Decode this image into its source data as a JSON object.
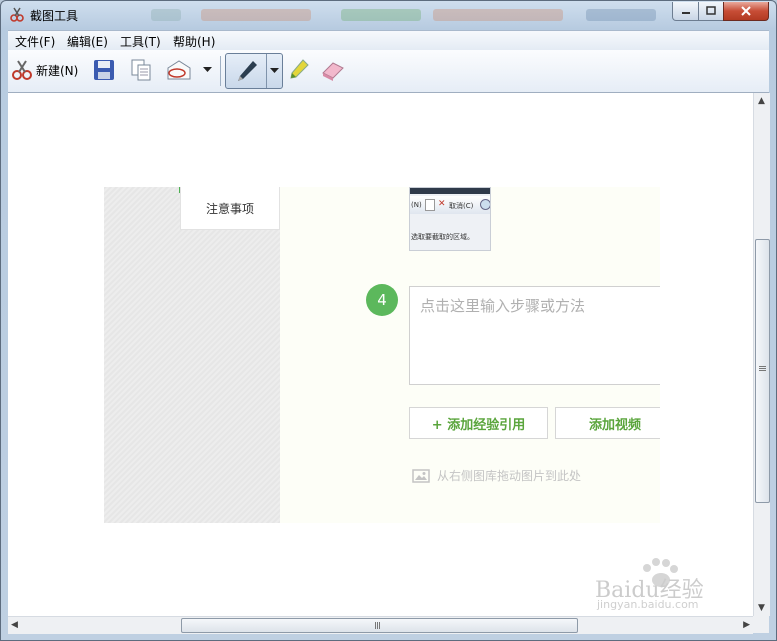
{
  "window": {
    "title": "截图工具"
  },
  "menu": {
    "items": [
      "文件(F)",
      "编辑(E)",
      "工具(T)",
      "帮助(H)"
    ]
  },
  "toolbar": {
    "new_label": "新建(N)"
  },
  "capture": {
    "sidebar_tab": "注意事项",
    "thumb_texts": [
      "(N)",
      "取消(C)",
      "选取要截取的区域。"
    ],
    "step_number": "4",
    "step_placeholder": "点击这里输入步骤或方法",
    "cite_button": "+ 添加经验引用",
    "video_button": "添加视频",
    "drag_hint": "从右侧图库拖动图片到此处"
  },
  "watermark": {
    "brand": "Baidu经验",
    "url": "jingyan.baidu.com"
  },
  "colors": {
    "accent_green": "#5cb85c",
    "title_bar": "#b7cbe0"
  }
}
